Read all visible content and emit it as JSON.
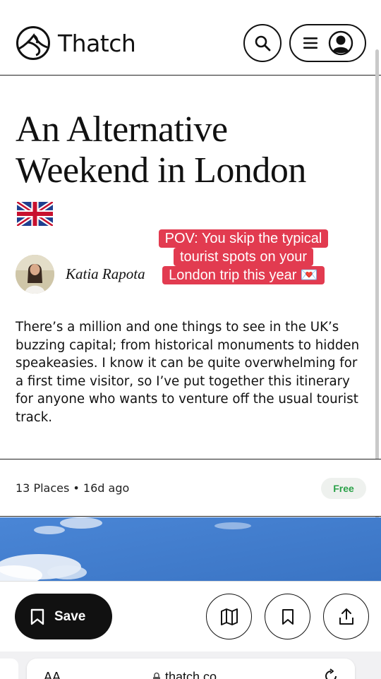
{
  "header": {
    "brand": "Thatch"
  },
  "article": {
    "title": "An Alternative Weekend in London",
    "flag_emoji": "🇬🇧",
    "author": "Katia Rapota",
    "intro": "There’s a million and one things to see in the UK’s buzzing capital; from historical monuments to hidden speakeasies. I know it can be quite overwhelming for a first time visitor, so I’ve put together this itinerary for anyone who wants to venture off the usual tourist track."
  },
  "overlay": {
    "line1": "POV: You skip the typical",
    "line2": "tourist spots on your",
    "line3": "London trip this year 💌"
  },
  "meta": {
    "summary": "13 Places • 16d ago",
    "price_badge": "Free"
  },
  "actions": {
    "save_label": "Save"
  },
  "browser": {
    "aa_label": "AA",
    "url": "thatch.co"
  },
  "colors": {
    "overlay_bg": "#e23b50",
    "badge_text": "#2aa148",
    "sky": "#3f7fd0"
  }
}
